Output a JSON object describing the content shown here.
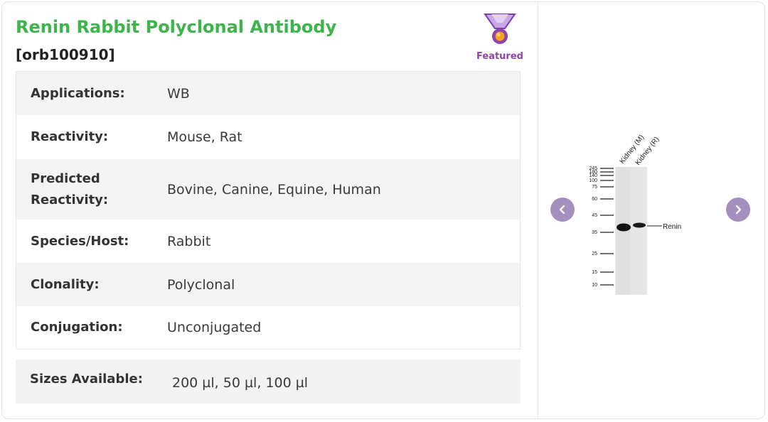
{
  "product": {
    "title": "Renin Rabbit Polyclonal Antibody",
    "catalog": "[orb100910]",
    "featured_label": "Featured"
  },
  "specs": [
    {
      "label": "Applications:",
      "value": "WB"
    },
    {
      "label": "Reactivity:",
      "value": "Mouse, Rat"
    },
    {
      "label": "Predicted Reactivity:",
      "value": "Bovine, Canine, Equine, Human"
    },
    {
      "label": "Species/Host:",
      "value": "Rabbit"
    },
    {
      "label": "Clonality:",
      "value": "Polyclonal"
    },
    {
      "label": "Conjugation:",
      "value": "Unconjugated"
    }
  ],
  "sizes": {
    "label": "Sizes Available:",
    "value": "200 µl, 50 µl, 100 µl"
  },
  "gallery": {
    "lanes": [
      "Kidney (M)",
      "Kidney (R)"
    ],
    "markers": [
      "245",
      "180",
      "140",
      "100",
      "75",
      "60",
      "45",
      "35",
      "25",
      "15",
      "10"
    ],
    "band_label": "Renin",
    "prev_icon": "chevron-left-icon",
    "next_icon": "chevron-right-icon"
  },
  "colors": {
    "title": "#3cb54a",
    "featured": "#8e44ad",
    "nav": "#a58fbf"
  }
}
